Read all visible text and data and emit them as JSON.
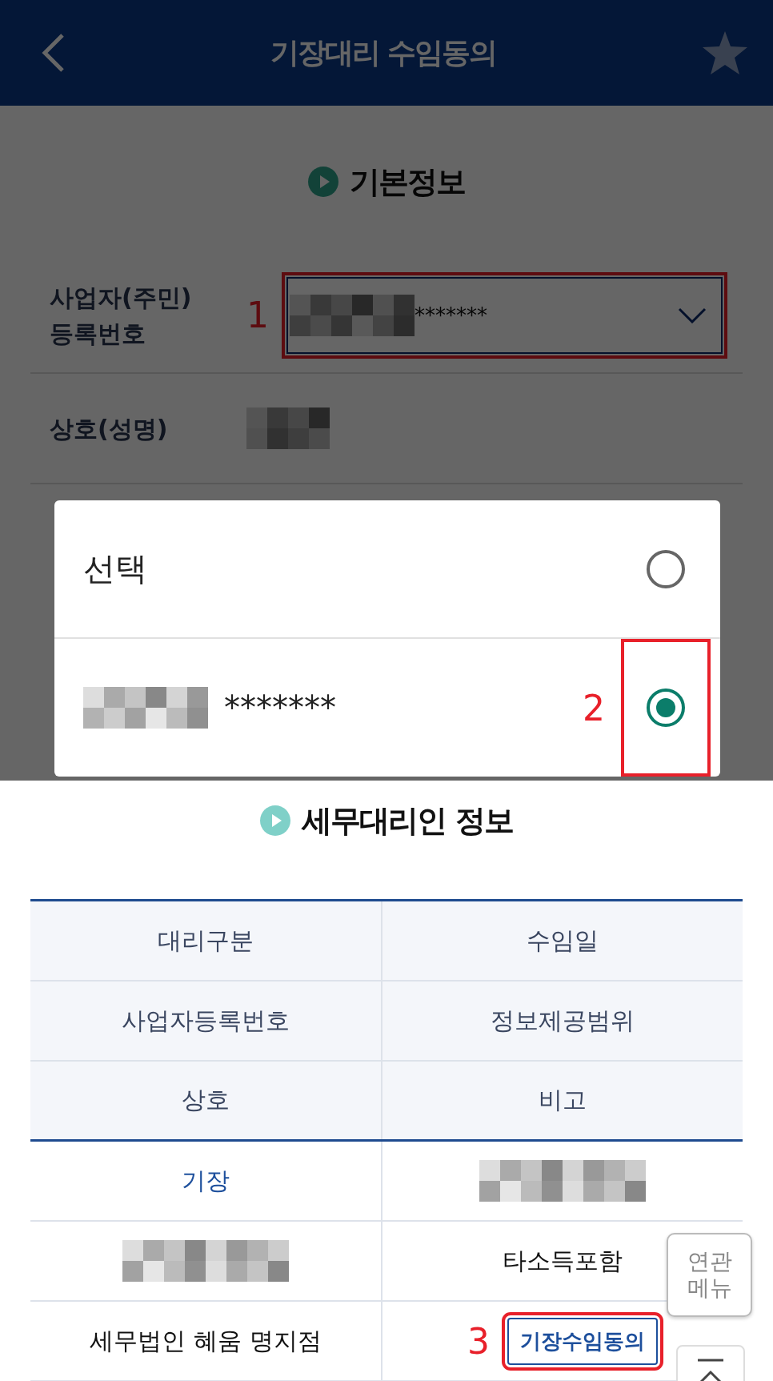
{
  "header": {
    "title": "기장대리 수임동의",
    "starred": false
  },
  "basic_info": {
    "title": "기본정보",
    "fields": [
      {
        "label": "사업자(주민)\n등록번호",
        "kind": "select",
        "value": "*******",
        "callout": "1"
      },
      {
        "label": "상호(성명)",
        "kind": "redacted"
      }
    ]
  },
  "dialog": {
    "options": [
      {
        "label": "선택",
        "kind": "text",
        "selected": false
      },
      {
        "label": "*******",
        "kind": "redacted",
        "selected": true,
        "callout": "2"
      }
    ]
  },
  "agent_info": {
    "title": "세무대리인 정보",
    "header_rows": [
      [
        "대리구분",
        "수임일"
      ],
      [
        "사업자등록번호",
        "정보제공범위"
      ],
      [
        "상호",
        "비고"
      ]
    ],
    "rows": [
      {
        "cells": [
          {
            "kind": "link",
            "text": "기장"
          },
          {
            "kind": "redacted"
          }
        ]
      },
      {
        "cells": [
          {
            "kind": "redacted"
          },
          {
            "kind": "text",
            "text": "타소득포함"
          }
        ]
      },
      {
        "cells": [
          {
            "kind": "text",
            "text": "세무법인 혜움 명지점"
          },
          {
            "kind": "button",
            "text": "기장수임동의",
            "callout": "3"
          }
        ]
      }
    ]
  },
  "related_menu": {
    "label": "연관\n메뉴"
  }
}
